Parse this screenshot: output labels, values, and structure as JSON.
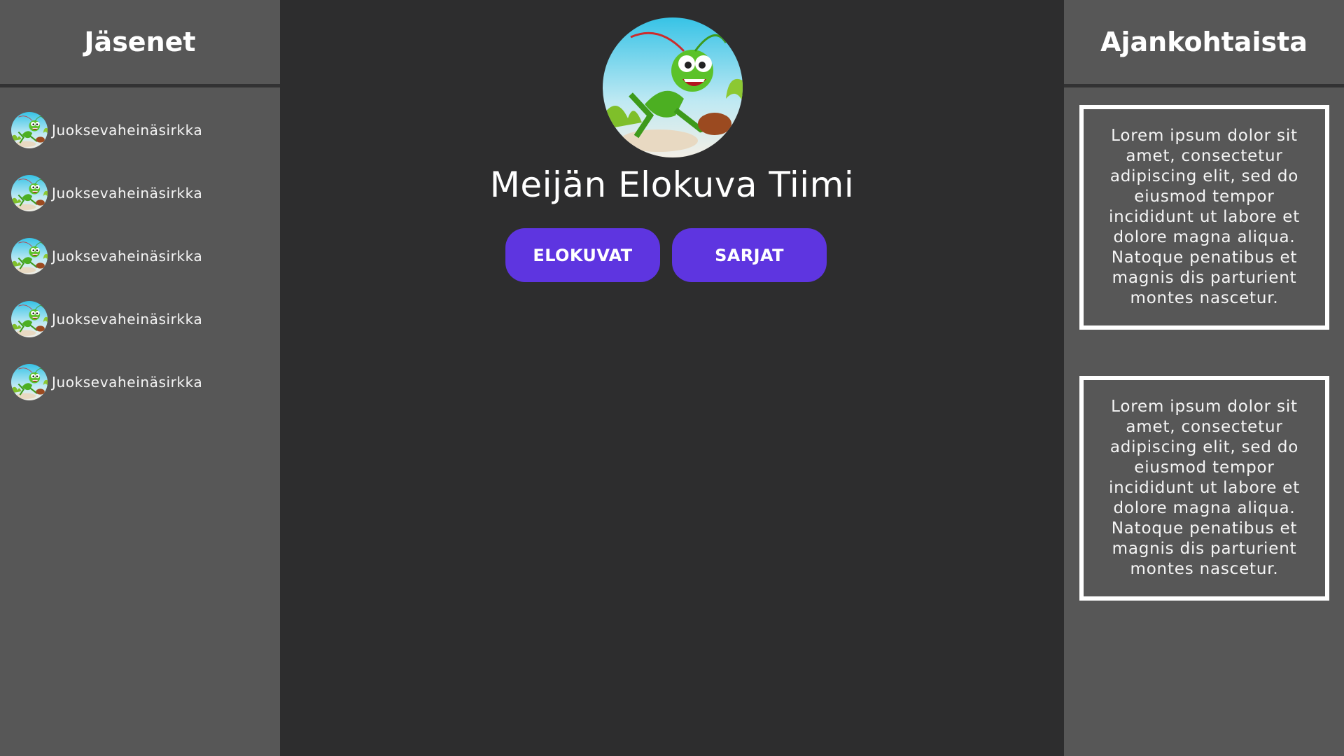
{
  "left_panel": {
    "title": "Jäsenet",
    "members": [
      {
        "name": "Juoksevaheinäsirkka"
      },
      {
        "name": "Juoksevaheinäsirkka"
      },
      {
        "name": "Juoksevaheinäsirkka"
      },
      {
        "name": "Juoksevaheinäsirkka"
      },
      {
        "name": "Juoksevaheinäsirkka"
      }
    ]
  },
  "main": {
    "logo_icon": "grasshopper-logo-icon",
    "title": "Meijän Elokuva Tiimi",
    "buttons": {
      "movies": "ELOKUVAT",
      "series": "SARJAT"
    },
    "accent_color": "#5e35e0"
  },
  "right_panel": {
    "title": "Ajankohtaista",
    "news": [
      {
        "text": "Lorem ipsum dolor sit amet, consectetur adipiscing elit, sed do eiusmod tempor incididunt ut labore et dolore magna aliqua. Natoque penatibus et magnis dis parturient montes nascetur."
      },
      {
        "text": "Lorem ipsum dolor sit amet, consectetur adipiscing elit, sed do eiusmod tempor incididunt ut labore et dolore magna aliqua. Natoque penatibus et magnis dis parturient montes nascetur."
      }
    ]
  }
}
